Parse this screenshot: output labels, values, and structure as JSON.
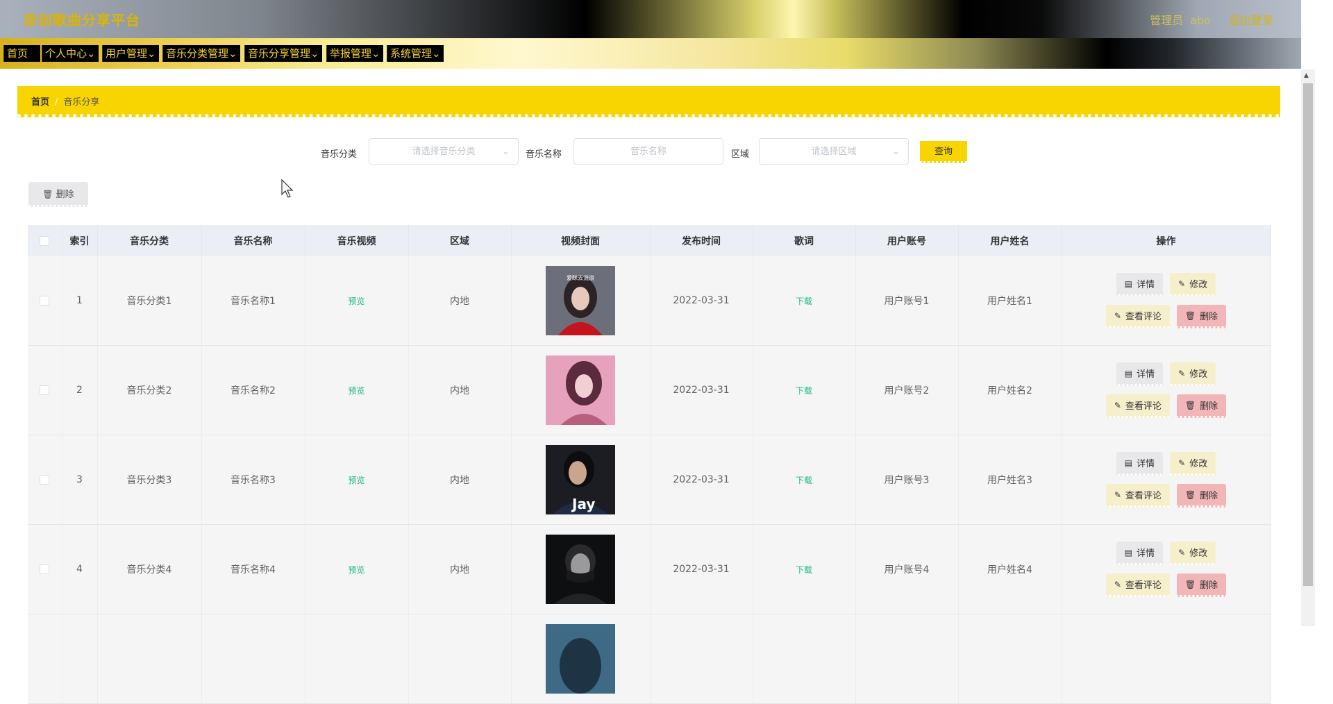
{
  "header": {
    "title": "原创歌曲分享平台",
    "role": "管理员",
    "username": "abo",
    "logout": "退出登录"
  },
  "menu": [
    "首页",
    "个人中心",
    "用户管理",
    "音乐分类管理",
    "音乐分享管理",
    "举报管理",
    "系统管理"
  ],
  "breadcrumb": {
    "home": "首页",
    "sep": "/",
    "current": "音乐分享"
  },
  "search": {
    "category_label": "音乐分类",
    "category_placeholder": "请选择音乐分类",
    "name_label": "音乐名称",
    "name_placeholder": "音乐名称",
    "region_label": "区域",
    "region_placeholder": "请选择区域",
    "query": "查询"
  },
  "toolbar": {
    "delete": "删除"
  },
  "table": {
    "headers": [
      "索引",
      "音乐分类",
      "音乐名称",
      "音乐视频",
      "区域",
      "视频封面",
      "发布时间",
      "歌词",
      "用户账号",
      "用户姓名",
      "操作"
    ],
    "rows": [
      {
        "index": "1",
        "category": "音乐分类1",
        "name": "音乐名称1",
        "video": "预览",
        "region": "内地",
        "cover": "girl-red",
        "date": "2022-03-31",
        "lyrics": "下载",
        "account": "用户账号1",
        "uname": "用户姓名1"
      },
      {
        "index": "2",
        "category": "音乐分类2",
        "name": "音乐名称2",
        "video": "预览",
        "region": "内地",
        "cover": "girl-pink",
        "date": "2022-03-31",
        "lyrics": "下载",
        "account": "用户账号2",
        "uname": "用户姓名2"
      },
      {
        "index": "3",
        "category": "音乐分类3",
        "name": "音乐名称3",
        "video": "预览",
        "region": "内地",
        "cover": "jay",
        "date": "2022-03-31",
        "lyrics": "下载",
        "account": "用户账号3",
        "uname": "用户姓名3"
      },
      {
        "index": "4",
        "category": "音乐分类4",
        "name": "音乐名称4",
        "video": "预览",
        "region": "内地",
        "cover": "man-dark",
        "date": "2022-03-31",
        "lyrics": "下载",
        "account": "用户账号4",
        "uname": "用户姓名4"
      }
    ],
    "actions": {
      "detail": "详情",
      "edit": "修改",
      "comments": "查看评论",
      "delete": "删除"
    }
  },
  "cover_texts": {
    "row1": "爱眯去流浪",
    "row3": "Jay"
  },
  "colors": {
    "accent": "#f8d400",
    "link_green": "#1db97f",
    "delete_bg": "#f2b6b8",
    "edit_bg": "#f6efcc"
  }
}
